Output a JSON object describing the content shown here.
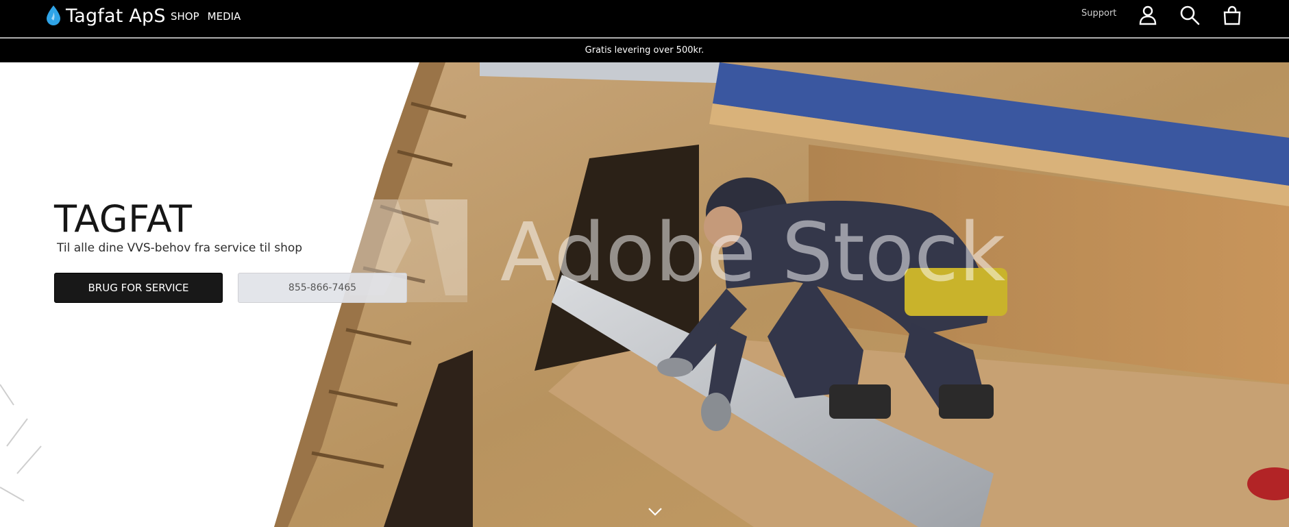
{
  "brand": {
    "name": "Tagfat ApS",
    "icon": "water-drop-icon",
    "accent_color": "#2fa4e7"
  },
  "nav": {
    "items": [
      {
        "label": "SHOP"
      },
      {
        "label": "MEDIA"
      }
    ]
  },
  "header": {
    "support_label": "Support",
    "icons": [
      "account-icon",
      "search-icon",
      "cart-icon"
    ]
  },
  "promo": {
    "text": "Gratis levering over 500kr."
  },
  "hero": {
    "title": "TAGFAT",
    "subtitle": "Til alle dine VVS-behov fra service til shop",
    "primary_button": "BRUG FOR SERVICE",
    "secondary_button": "855-866-7465",
    "watermark": "Adobe Stock",
    "scroll_icon": "chevron-down-icon"
  }
}
